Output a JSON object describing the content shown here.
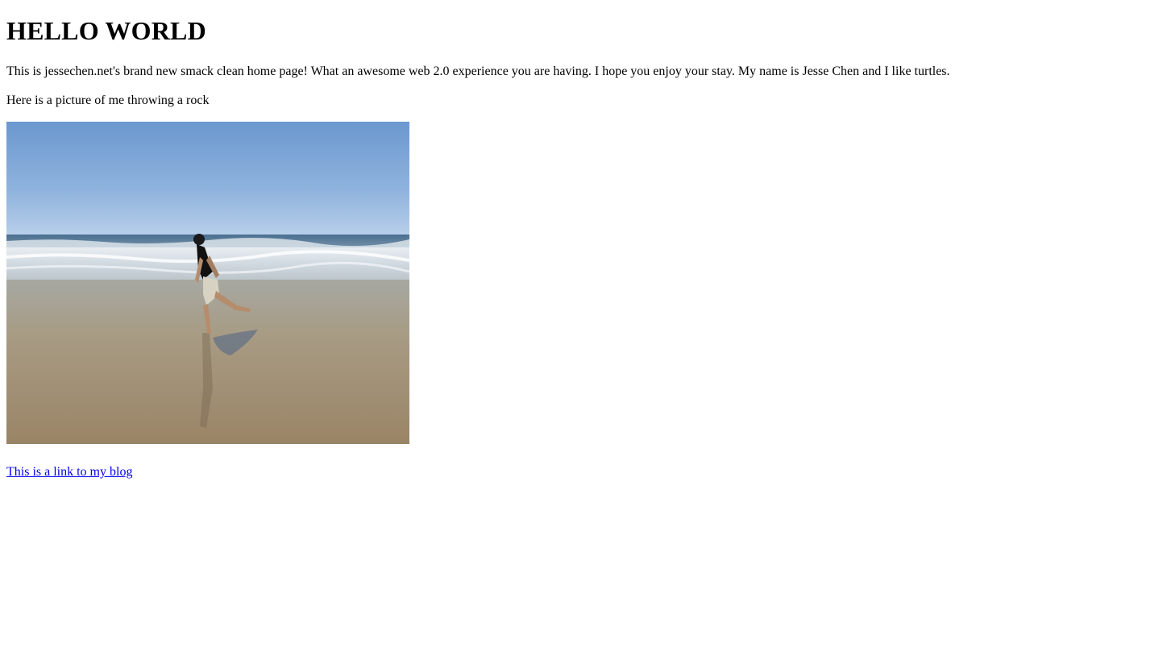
{
  "page": {
    "heading": "HELLO WORLD",
    "intro": "This is jessechen.net's brand new smack clean home page! What an awesome web 2.0 experience you are having. I hope you enjoy your stay. My name is Jesse Chen and I like turtles.",
    "photo_caption": "Here is a picture of me throwing a rock",
    "blog_link": "This is a link to my blog"
  },
  "colors": {
    "text": "#000000",
    "link": "#0000ee",
    "background": "#ffffff"
  }
}
